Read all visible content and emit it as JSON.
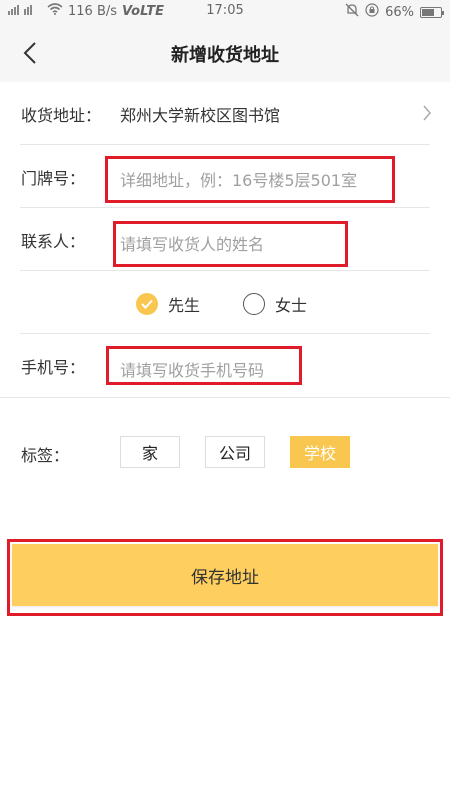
{
  "status_bar": {
    "signal": "೼೼❙❙",
    "net_speed": "116 B/s",
    "volte": "VoLTE",
    "time": "17:05",
    "battery": "66%",
    "battery_level": 0.66
  },
  "header": {
    "title": "新增收货地址"
  },
  "form": {
    "address": {
      "label": "收货地址：",
      "value": "郑州大学新校区图书馆"
    },
    "door": {
      "label": "门牌号：",
      "placeholder": "详细地址，例：16号楼5层501室"
    },
    "contact": {
      "label": "联系人：",
      "placeholder": "请填写收货人的姓名"
    },
    "gender": {
      "options": [
        "先生",
        "女士"
      ],
      "selected": "先生"
    },
    "phone": {
      "label": "手机号：",
      "placeholder": "请填写收货手机号码"
    }
  },
  "tags": {
    "label": "标签：",
    "items": [
      "家",
      "公司",
      "学校"
    ],
    "selected": "学校"
  },
  "save_button": "保存地址",
  "colors": {
    "accent": "#f9c74f",
    "save_button": "#fecf5e",
    "highlight_box": "#e01b2a"
  }
}
